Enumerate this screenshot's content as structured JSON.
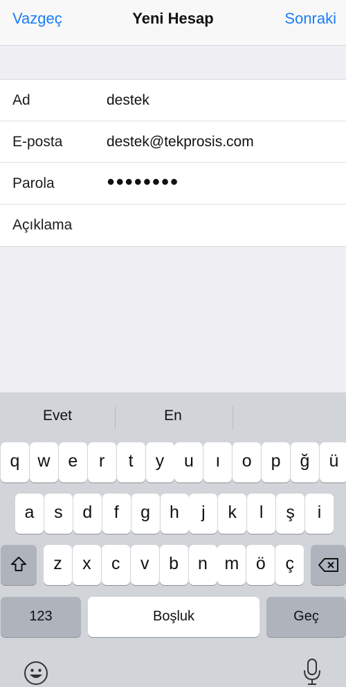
{
  "navbar": {
    "cancel_label": "Vazgeç",
    "title": "Yeni Hesap",
    "next_label": "Sonraki"
  },
  "form": {
    "rows": [
      {
        "label": "Ad",
        "value": "destek"
      },
      {
        "label": "E-posta",
        "value": "destek@tekprosis.com"
      },
      {
        "label": "Parola",
        "value": "●●●●●●●●"
      },
      {
        "label": "Açıklama",
        "value": ""
      }
    ]
  },
  "keyboard": {
    "suggestions": [
      "Evet",
      "En"
    ],
    "row1": [
      "q",
      "w",
      "e",
      "r",
      "t",
      "y",
      "u",
      "ı",
      "o",
      "p",
      "ğ",
      "ü"
    ],
    "row2": [
      "a",
      "s",
      "d",
      "f",
      "g",
      "h",
      "j",
      "k",
      "l",
      "ş",
      "i"
    ],
    "row3": [
      "z",
      "x",
      "c",
      "v",
      "b",
      "n",
      "m",
      "ö",
      "ç"
    ],
    "numbers_label": "123",
    "space_label": "Boşluk",
    "return_label": "Geç",
    "icons": {
      "shift": "shift-icon",
      "backspace": "backspace-icon",
      "emoji": "emoji-icon",
      "mic": "microphone-icon"
    }
  },
  "colors": {
    "accent": "#1a7ef5",
    "keyboard_bg": "#d1d4d9",
    "page_bg": "#efeff4"
  }
}
